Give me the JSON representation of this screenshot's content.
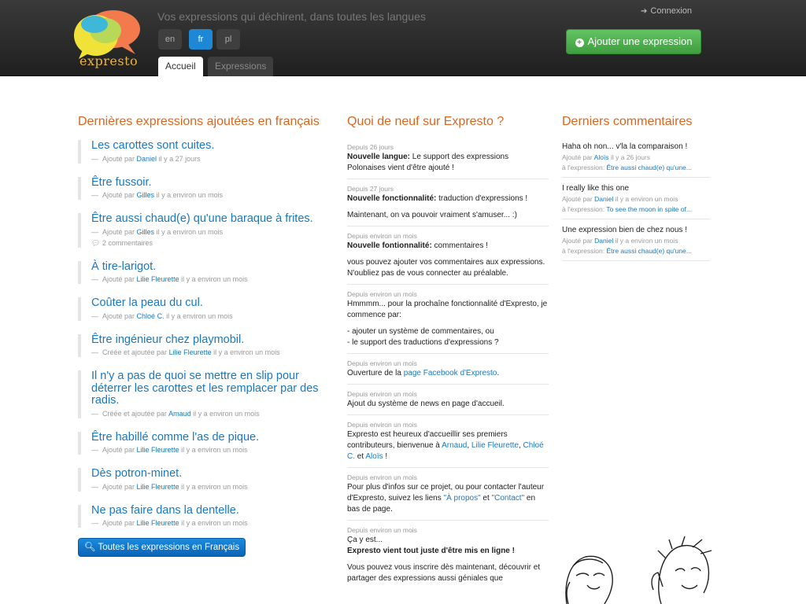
{
  "header": {
    "logo_text": "expresto",
    "tagline": "Vos expressions qui déchirent, dans toutes les langues",
    "languages": [
      "en",
      "fr",
      "pl"
    ],
    "active_language": "fr",
    "tabs": [
      "Accueil",
      "Expressions"
    ],
    "login_label": "Connexion",
    "add_button_label": "Ajouter une expression"
  },
  "left": {
    "title": "Dernières expressions ajoutées en français",
    "expressions": [
      {
        "text": "Les carottes sont cuites.",
        "prefix": "Ajouté par",
        "author": "Daniel",
        "time": "il y a 27 jours"
      },
      {
        "text": "Être fussoir.",
        "prefix": "Ajouté par",
        "author": "Gilles",
        "time": "il y a environ un mois"
      },
      {
        "text": "Être aussi chaud(e) qu'une baraque à frites.",
        "prefix": "Ajouté par",
        "author": "Gilles",
        "time": "il y a environ un mois",
        "comments": "2 commentaires"
      },
      {
        "text": "À tire-larigot.",
        "prefix": "Ajouté par",
        "author": "Lilie Fleurette",
        "time": "il y a environ un mois"
      },
      {
        "text": "Coûter la peau du cul.",
        "prefix": "Ajouté par",
        "author": "Chloé C.",
        "time": "il y a environ un mois"
      },
      {
        "text": "Être ingénieur chez playmobil.",
        "prefix": "Créée et ajoutée par",
        "author": "Lilie Fleurette",
        "time": "il y a environ un mois"
      },
      {
        "text": "Il n'y a pas de quoi se mettre en slip pour déterrer les carottes et les remplacer par des radis.",
        "prefix": "Créée et ajoutée par",
        "author": "Amaud",
        "time": "il y a environ un mois"
      },
      {
        "text": "Être habillé comme l'as de pique.",
        "prefix": "Ajouté par",
        "author": "Lilie Fleurette",
        "time": "il y a environ un mois"
      },
      {
        "text": "Dès potron-minet.",
        "prefix": "Ajouté par",
        "author": "Lilie Fleurette",
        "time": "il y a environ un mois"
      },
      {
        "text": "Ne pas faire dans la dentelle.",
        "prefix": "Ajouté par",
        "author": "Lilie Fleurette",
        "time": "il y a environ un mois"
      }
    ],
    "all_button_label": "Toutes les expressions en Français"
  },
  "middle": {
    "title": "Quoi de neuf sur Expresto ?",
    "news": [
      {
        "date": "Depuis 26 jours",
        "bold": "Nouvelle langue:",
        "text": " Le support des expressions Polonaises vient d'être ajouté !"
      },
      {
        "date": "Depuis 27 jours",
        "bold": "Nouvelle fonctionnalité:",
        "text": " traduction d'expressions !",
        "extra": "Maintenant, on va pouvoir vraiment s'amuser... :)"
      },
      {
        "date": "Depuis environ un mois",
        "bold": "Nouvelle fontionnalité:",
        "text": " commentaires !",
        "extra": "vous pouvez ajouter vos commentaires aux expressions. N'oubliez pas de vous connecter au préalable."
      },
      {
        "date": "Depuis environ un mois",
        "text": "Hmmmm... pour la prochaîne fonctionnalité d'Expresto, je commence par:",
        "list": [
          "- ajouter un système de commentaires, ou",
          "- le support des traductions d'expressions ?"
        ]
      },
      {
        "date": "Depuis environ un mois",
        "text_before": "Ouverture de la ",
        "link": "page Facebook d'Expresto",
        "text_after": "."
      },
      {
        "date": "Depuis environ un mois",
        "text": "Ajout du système de news en page d'accueil."
      },
      {
        "date": "Depuis environ un mois",
        "text": "Expresto est heureux d'accueillir ses premiers contributeurs, bienvenue à",
        "links": [
          "Arnaud",
          "Lilie Fleurette",
          "Chloé C.",
          "Aloïs"
        ],
        "sep_and": "et",
        "end": "!"
      },
      {
        "date": "Depuis environ un mois",
        "text_before": "Pour plus d'infos sur ce projet, ou pour contacter l'auteur d'Expresto, suivez les liens ",
        "link1": "\"À propos\"",
        "mid": " et ",
        "link2": "\"Contact\"",
        "text_after": " en bas de page."
      },
      {
        "date": "Depuis environ un mois",
        "text": "Ça y est...",
        "bold": "Expresto vient tout juste d'être mis en ligne !",
        "extra": "Vous pouvez vous inscrire dès maintenant, découvrir et partager des expressions aussi géniales que"
      }
    ]
  },
  "right": {
    "title": "Derniers commentaires",
    "comments": [
      {
        "quote": "Haha oh non... v'la la comparaison !",
        "prefix": "Ajouté par",
        "author": "Aloïs",
        "time": "il y a 26 jours",
        "expr_label": "à l'expression:",
        "expr": "Être aussi chaud(e) qu'une..."
      },
      {
        "quote": "I really like this one",
        "prefix": "Ajouté par",
        "author": "Daniel",
        "time": "il y a environ un mois",
        "expr_label": "à l'expression:",
        "expr": "To see the moon in spite of..."
      },
      {
        "quote": "Une expression bien de chez nous !",
        "prefix": "Ajouté par",
        "author": "Daniel",
        "time": "il y a environ un mois",
        "expr_label": "à l'expression:",
        "expr": "Être aussi chaud(e) qu'une..."
      }
    ]
  },
  "colors": {
    "accent_orange": "#d9661f",
    "link_blue": "#1a78c2",
    "add_green": "#4aa84a"
  }
}
